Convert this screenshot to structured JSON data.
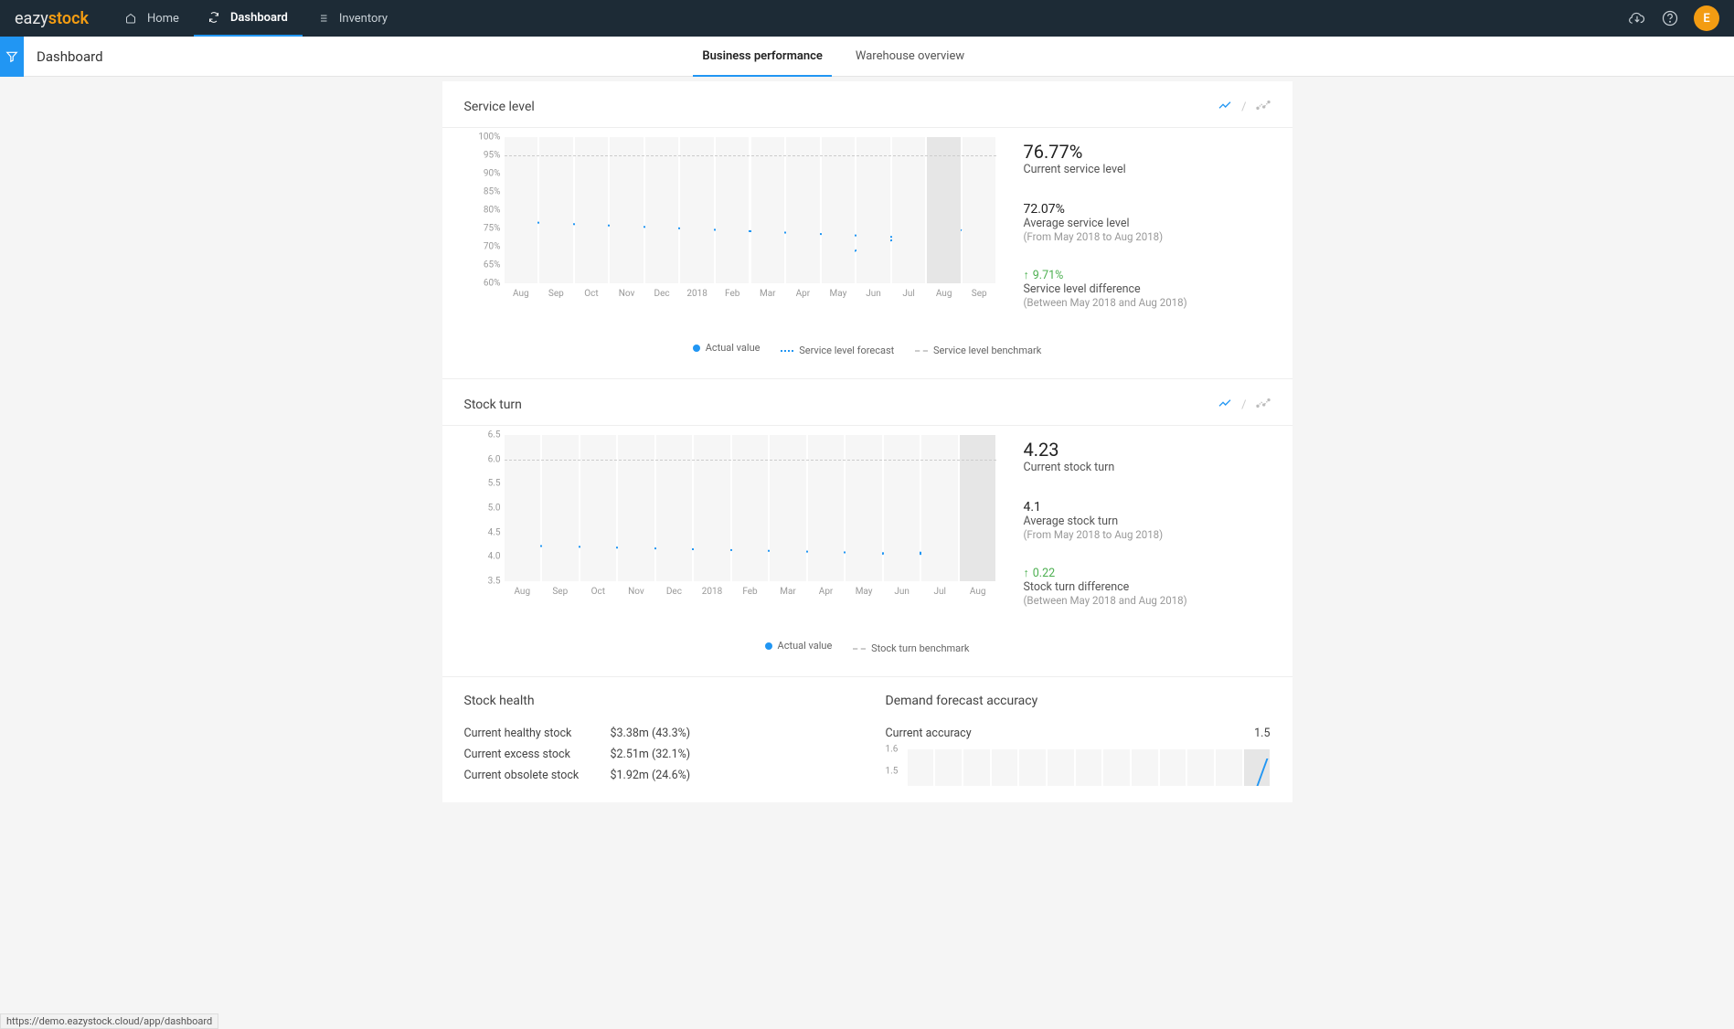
{
  "brand": {
    "part1": "eazy",
    "part2": "stock"
  },
  "nav": {
    "home": "Home",
    "dashboard": "Dashboard",
    "inventory": "Inventory"
  },
  "avatar_initial": "E",
  "page_title": "Dashboard",
  "tabs": {
    "business": "Business performance",
    "warehouse": "Warehouse overview"
  },
  "service_level": {
    "title": "Service level",
    "stats": {
      "current_value": "76.77%",
      "current_label": "Current service level",
      "avg_value": "72.07%",
      "avg_label": "Average service level",
      "avg_range": "(From May 2018 to Aug 2018)",
      "delta_value": "9.71%",
      "delta_label": "Service level difference",
      "delta_range": "(Between May 2018 and Aug 2018)"
    },
    "legend": {
      "actual": "Actual value",
      "forecast": "Service level forecast",
      "benchmark": "Service level benchmark"
    }
  },
  "stock_turn": {
    "title": "Stock turn",
    "stats": {
      "current_value": "4.23",
      "current_label": "Current stock turn",
      "avg_value": "4.1",
      "avg_label": "Average stock turn",
      "avg_range": "(From May 2018 to Aug 2018)",
      "delta_value": "0.22",
      "delta_label": "Stock turn difference",
      "delta_range": "(Between May 2018 and Aug 2018)"
    },
    "legend": {
      "actual": "Actual value",
      "benchmark": "Stock turn benchmark"
    }
  },
  "stock_health": {
    "title": "Stock health",
    "rows": [
      {
        "key": "Current healthy stock",
        "val": "$3.38m (43.3%)"
      },
      {
        "key": "Current excess stock",
        "val": "$2.51m (32.1%)"
      },
      {
        "key": "Current obsolete stock",
        "val": "$1.92m (24.6%)"
      }
    ]
  },
  "forecast_accuracy": {
    "title": "Demand forecast accuracy",
    "row_key": "Current accuracy",
    "row_val": "1.5",
    "y_ticks": [
      "1.6",
      "1.5"
    ]
  },
  "status_url": "https://demo.eazystock.cloud/app/dashboard",
  "chart_data": [
    {
      "id": "service_level",
      "type": "line",
      "title": "Service level",
      "xlabel": "",
      "ylabel": "",
      "categories": [
        "Aug",
        "Sep",
        "Oct",
        "Nov",
        "Dec",
        "2018",
        "Feb",
        "Mar",
        "Apr",
        "May",
        "Jun",
        "Jul",
        "Aug",
        "Sep"
      ],
      "y_ticks": [
        "100%",
        "95%",
        "90%",
        "85%",
        "80%",
        "75%",
        "70%",
        "65%",
        "60%"
      ],
      "ylim": [
        60,
        100
      ],
      "benchmark": 95,
      "highlight_category": "Aug",
      "series": [
        {
          "name": "Actual value",
          "x": [
            "May",
            "Jun",
            "Jul",
            "Aug"
          ],
          "y": [
            67,
            71,
            72.5,
            76.77
          ]
        },
        {
          "name": "Service level forecast",
          "x": [
            "Aug",
            "Sep"
          ],
          "y": [
            76.77,
            72
          ]
        }
      ]
    },
    {
      "id": "stock_turn",
      "type": "line",
      "title": "Stock turn",
      "xlabel": "",
      "ylabel": "",
      "categories": [
        "Aug",
        "Sep",
        "Oct",
        "Nov",
        "Dec",
        "2018",
        "Feb",
        "Mar",
        "Apr",
        "May",
        "Jun",
        "Jul",
        "Aug"
      ],
      "y_ticks": [
        "6.5",
        "6.0",
        "5.5",
        "5.0",
        "4.5",
        "4.0",
        "3.5"
      ],
      "ylim": [
        3.5,
        6.5
      ],
      "benchmark": 6.0,
      "highlight_category": "Aug",
      "series": [
        {
          "name": "Actual value",
          "x": [
            "May",
            "Jun",
            "Jul",
            "Aug"
          ],
          "y": [
            4.01,
            4.12,
            4.05,
            4.23
          ]
        }
      ]
    }
  ]
}
